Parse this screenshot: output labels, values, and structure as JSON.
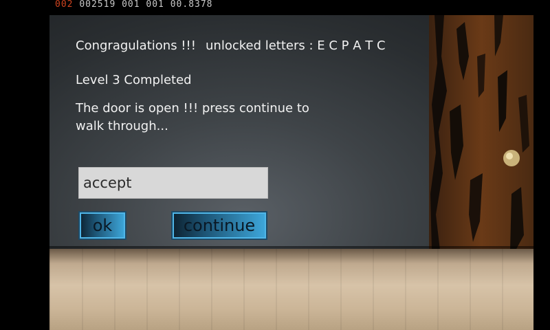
{
  "debug_bar": {
    "prefix": "002",
    "values": "002519 001 001 00.8378"
  },
  "dialog": {
    "congrats": "Congragulations !!!",
    "unlocked": "unlocked letters : E C P A T C",
    "level": "Level  3  Completed",
    "door_message": "The door is open !!! press continue to walk through...",
    "input_value": "accept",
    "ok_label": "ok",
    "continue_label": "continue"
  },
  "colors": {
    "button_accent": "#3ea8dc",
    "debug_prefix": "#d0441f"
  }
}
